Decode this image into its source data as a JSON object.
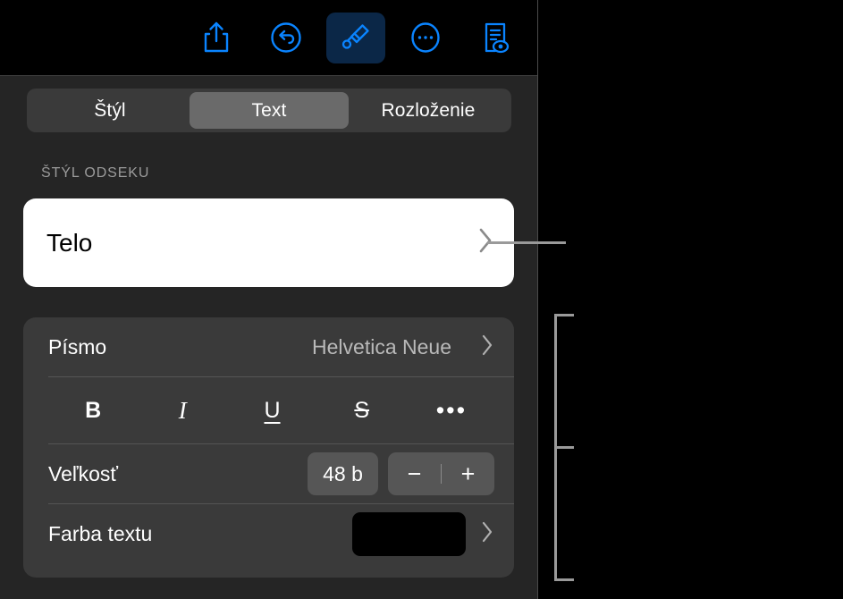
{
  "toolbar": {
    "buttons": [
      {
        "name": "share-icon",
        "label": "Zdieľať",
        "active": false
      },
      {
        "name": "undo-icon",
        "label": "Späť",
        "active": false
      },
      {
        "name": "paintbrush-icon",
        "label": "Formát",
        "active": true
      },
      {
        "name": "more-icon",
        "label": "Viac",
        "active": false
      },
      {
        "name": "document-view-icon",
        "label": "Zobraziť",
        "active": false
      }
    ]
  },
  "segmented": {
    "items": [
      {
        "label": "Štýl",
        "selected": false
      },
      {
        "label": "Text",
        "selected": true
      },
      {
        "label": "Rozloženie",
        "selected": false
      }
    ]
  },
  "paragraph": {
    "section_label": "ŠTÝL ODSEKU",
    "value": "Telo",
    "chevron": "›"
  },
  "font": {
    "font_row_label": "Písmo",
    "font_value": "Helvetica Neue",
    "chevron": "›",
    "format_buttons": [
      {
        "name": "bold-button",
        "label": "B"
      },
      {
        "name": "italic-button",
        "label": "I"
      },
      {
        "name": "underline-button",
        "label": "U"
      },
      {
        "name": "strikethrough-button",
        "label": "S"
      },
      {
        "name": "more-format-button",
        "label": "•••"
      }
    ],
    "size_label": "Veľkosť",
    "size_value": "48 b",
    "minus": "−",
    "plus": "+",
    "color_label": "Farba textu",
    "color_value": "#000000"
  },
  "colors": {
    "panel_bg": "#252525",
    "card_bg": "#3a3a3a",
    "accent_blue": "#0a84ff",
    "active_tab_bg": "#6a6a6a",
    "active_tool_bg": "#0b2747",
    "callout": "#9a9a9a"
  }
}
